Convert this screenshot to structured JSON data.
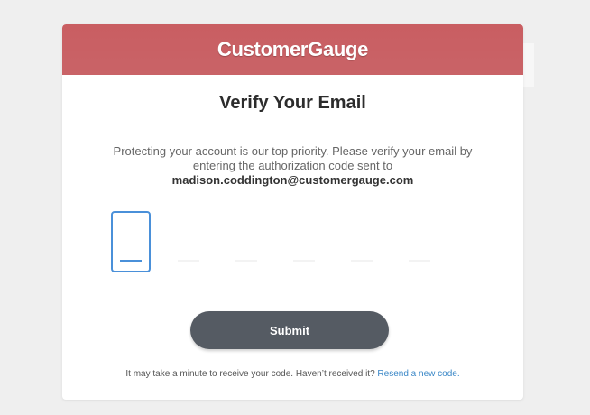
{
  "header": {
    "brand": "CustomerGauge"
  },
  "main": {
    "title": "Verify Your Email",
    "description": "Protecting your account is our top priority. Please verify your email by entering the authorization code sent to",
    "email": "madison.coddington@customergauge.com",
    "code_boxes": [
      {
        "value": ""
      },
      {
        "value": ""
      },
      {
        "value": ""
      },
      {
        "value": ""
      },
      {
        "value": ""
      },
      {
        "value": ""
      }
    ],
    "submit_label": "Submit",
    "footer_text": "It may take a minute to receive your code. Haven’t received it?",
    "resend_label": "Resend a new code."
  },
  "colors": {
    "header": "#c96367",
    "accent": "#4a90d9",
    "button": "#555b63",
    "link": "#3a87c7"
  }
}
